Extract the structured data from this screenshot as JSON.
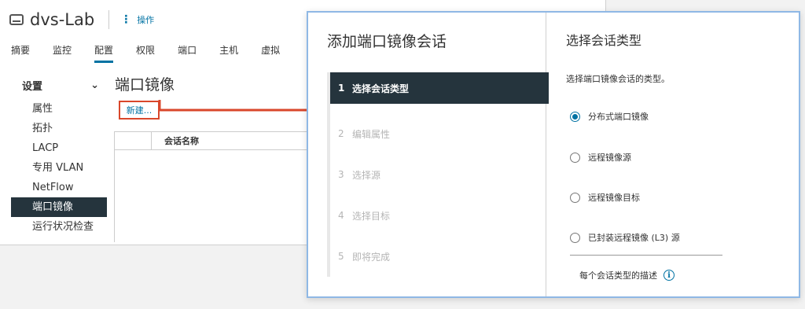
{
  "header": {
    "title": "dvs-Lab",
    "actions_label": "操作",
    "kebab": "⋮"
  },
  "tabs": [
    {
      "label": "摘要"
    },
    {
      "label": "监控"
    },
    {
      "label": "配置"
    },
    {
      "label": "权限"
    },
    {
      "label": "端口"
    },
    {
      "label": "主机"
    },
    {
      "label": "虚拟"
    }
  ],
  "left_nav": {
    "section": "设置",
    "chevron": "⌄",
    "items": [
      {
        "label": "属性"
      },
      {
        "label": "拓扑"
      },
      {
        "label": "LACP"
      },
      {
        "label": "专用 VLAN"
      },
      {
        "label": "NetFlow"
      },
      {
        "label": "端口镜像"
      },
      {
        "label": "运行状况检查"
      }
    ]
  },
  "content": {
    "title": "端口镜像",
    "new_button": "新建...",
    "grid_column": "会话名称"
  },
  "dialog": {
    "title": "添加端口镜像会话",
    "steps": [
      {
        "num": "1",
        "label": "选择会话类型"
      },
      {
        "num": "2",
        "label": "编辑属性"
      },
      {
        "num": "3",
        "label": "选择源"
      },
      {
        "num": "4",
        "label": "选择目标"
      },
      {
        "num": "5",
        "label": "即将完成"
      }
    ],
    "right_title": "选择会话类型",
    "right_desc": "选择端口镜像会话的类型。",
    "options": [
      {
        "label": "分布式端口镜像",
        "checked": true
      },
      {
        "label": "远程镜像源",
        "checked": false
      },
      {
        "label": "远程镜像目标",
        "checked": false
      },
      {
        "label": "已封装远程镜像 (L3) 源",
        "checked": false
      }
    ],
    "footer_text": "每个会话类型的描述",
    "info_glyph": "i"
  },
  "colors": {
    "accent": "#0072a3",
    "highlight": "#d9472b",
    "nav_active": "#25343d"
  }
}
